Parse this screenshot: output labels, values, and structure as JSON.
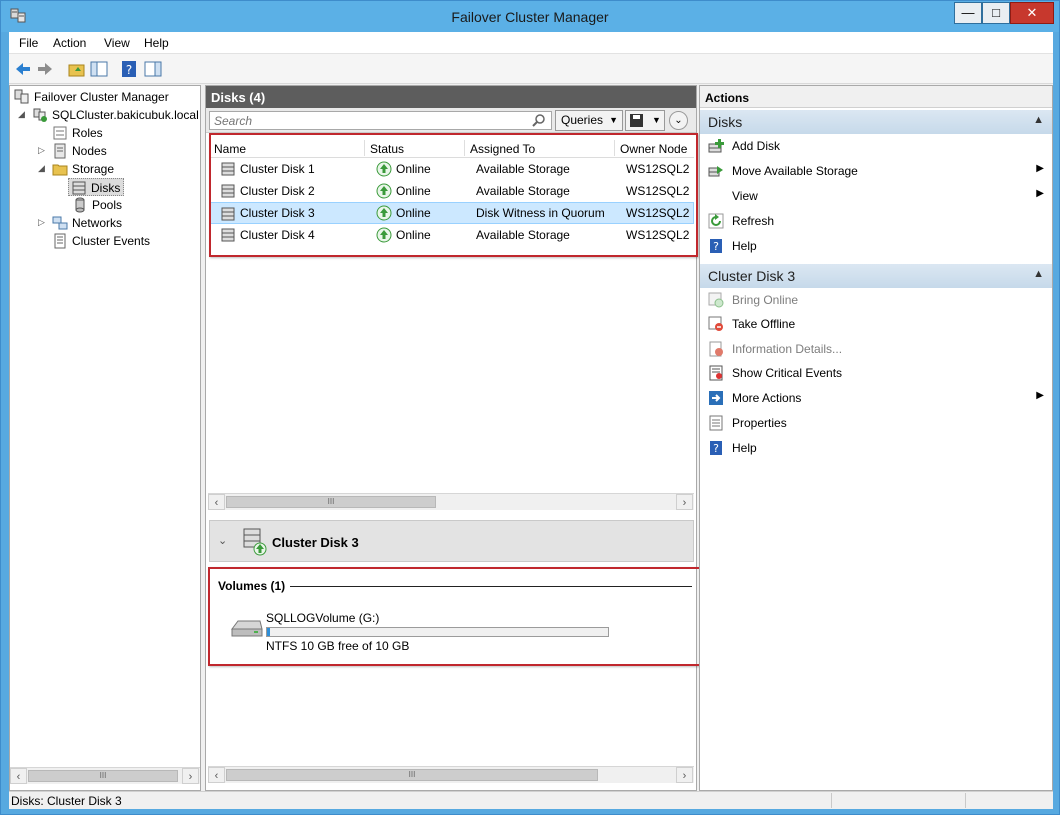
{
  "window": {
    "title": "Failover Cluster Manager"
  },
  "menu": [
    "File",
    "Action",
    "View",
    "Help"
  ],
  "tree": {
    "root": "Failover Cluster Manager",
    "cluster": "SQLCluster.bakicubuk.local",
    "items": [
      {
        "label": "Roles"
      },
      {
        "label": "Nodes"
      },
      {
        "label": "Storage"
      },
      {
        "label": "Disks"
      },
      {
        "label": "Pools"
      },
      {
        "label": "Networks"
      },
      {
        "label": "Cluster Events"
      }
    ]
  },
  "center": {
    "header": "Disks (4)",
    "search_placeholder": "Search",
    "queries_label": "Queries",
    "columns": [
      "Name",
      "Status",
      "Assigned To",
      "Owner Node"
    ],
    "rows": [
      {
        "name": "Cluster Disk 1",
        "status": "Online",
        "assigned": "Available Storage",
        "owner": "WS12SQL2"
      },
      {
        "name": "Cluster Disk 2",
        "status": "Online",
        "assigned": "Available Storage",
        "owner": "WS12SQL2"
      },
      {
        "name": "Cluster Disk 3",
        "status": "Online",
        "assigned": "Disk Witness in Quorum",
        "owner": "WS12SQL2"
      },
      {
        "name": "Cluster Disk 4",
        "status": "Online",
        "assigned": "Available Storage",
        "owner": "WS12SQL2"
      }
    ],
    "detail": {
      "title": "Cluster Disk 3",
      "volumes_label": "Volumes (1)",
      "volume_name": "SQLLOGVolume (G:)",
      "volume_free": "NTFS 10 GB free of 10 GB",
      "used_fraction": 0.01
    }
  },
  "actions": {
    "title": "Actions",
    "section1": "Disks",
    "section1_items": [
      {
        "label": "Add Disk"
      },
      {
        "label": "Move Available Storage"
      },
      {
        "label": "View"
      },
      {
        "label": "Refresh"
      },
      {
        "label": "Help"
      }
    ],
    "section2": "Cluster Disk 3",
    "section2_items": [
      {
        "label": "Bring Online"
      },
      {
        "label": "Take Offline"
      },
      {
        "label": "Information Details..."
      },
      {
        "label": "Show Critical Events"
      },
      {
        "label": "More Actions"
      },
      {
        "label": "Properties"
      },
      {
        "label": "Help"
      }
    ]
  },
  "statusbar": {
    "text": "Disks:  Cluster Disk 3"
  },
  "colors": {
    "accent": "#5bb0e6",
    "selection": "#cce8ff",
    "highlight_box": "#c0272d",
    "online_green": "#3a9a3a"
  }
}
